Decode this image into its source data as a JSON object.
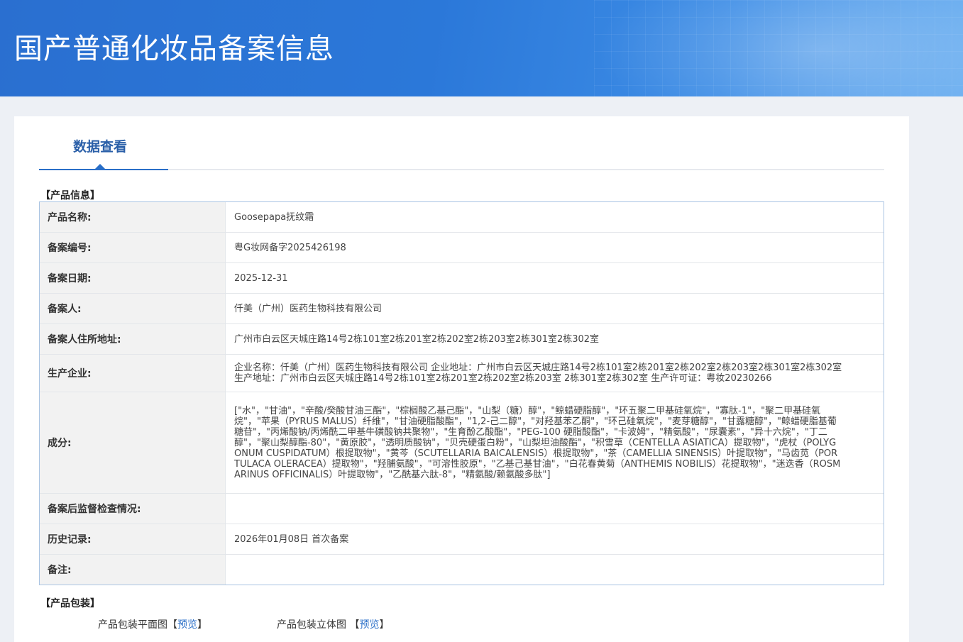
{
  "banner": {
    "title": "国产普通化妆品备案信息"
  },
  "tabs": [
    {
      "label": "数据查看"
    }
  ],
  "product_info": {
    "section_title": "【产品信息】",
    "rows": [
      {
        "label": "产品名称:",
        "value": "Goosepapa抚纹霜"
      },
      {
        "label": "备案编号:",
        "value": "粤G妆网备字2025426198"
      },
      {
        "label": "备案日期:",
        "value": "2025-12-31"
      },
      {
        "label": "备案人:",
        "value": "仟美（广州）医药生物科技有限公司"
      },
      {
        "label": "备案人住所地址:",
        "value": "广州市白云区天城庄路14号2栋101室2栋201室2栋202室2栋203室2栋301室2栋302室"
      },
      {
        "label": "生产企业:",
        "value": "企业名称：仟美（广州）医药生物科技有限公司 企业地址：广州市白云区天城庄路14号2栋101室2栋201室2栋202室2栋203室2栋301室2栋302室 生产地址：广州市白云区天城庄路14号2栋101室2栋201室2栋202室2栋203室 2栋301室2栋302室 生产许可证：粤妆20230266"
      },
      {
        "label": "成分:",
        "value": "[\"水\"，\"甘油\"，\"辛酸/癸酸甘油三酯\"，\"棕榈酸乙基己酯\"，\"山梨（糖）醇\"，\"鲸蜡硬脂醇\"，\"环五聚二甲基硅氧烷\"，\"寡肽-1\"，\"聚二甲基硅氧烷\"，\"苹果（PYRUS MALUS）纤维\"，\"甘油硬脂酸酯\"，\"1,2-己二醇\"，\"对羟基苯乙酮\"，\"环己硅氧烷\"，\"麦芽糖醇\"，\"甘露糖醇\"，\"鲸蜡硬脂基葡糖苷\"，\"丙烯酸钠/丙烯酰二甲基牛磺酸钠共聚物\"，\"生育酚乙酸酯\"，\"PEG-100 硬脂酸酯\"，\"卡波姆\"，\"精氨酸\"，\"尿囊素\"，\"异十六烷\"，\"丁二醇\"，\"聚山梨醇酯-80\"，\"黄原胶\"，\"透明质酸钠\"，\"贝壳硬蛋白粉\"，\"山梨坦油酸酯\"，\"积雪草（CENTELLA ASIATICA）提取物\"，\"虎杖（POLYGONUM CUSPIDATUM）根提取物\"，\"黄芩（SCUTELLARIA BAICALENSIS）根提取物\"，\"茶（CAMELLIA SINENSIS）叶提取物\"，\"马齿苋（PORTULACA OLERACEA）提取物\"，\"羟脯氨酸\"，\"可溶性胶原\"，\"乙基己基甘油\"，\"白花春黄菊（ANTHEMIS NOBILIS）花提取物\"，\"迷迭香（ROSMARINUS OFFICINALIS）叶提取物\"，\"乙酰基六肽-8\"，\"精氨酸/赖氨酸多肽\"]"
      },
      {
        "label": "备案后监督检查情况:",
        "value": ""
      },
      {
        "label": "历史记录:",
        "value": "2026年01月08日 首次备案"
      },
      {
        "label": "备注:",
        "value": ""
      }
    ]
  },
  "packaging": {
    "section_title": "【产品包装】",
    "flat_label": "产品包装平面图",
    "stereo_label": "产品包装立体图",
    "bracket_open": "【",
    "bracket_close": "】",
    "preview_label": "预览"
  }
}
